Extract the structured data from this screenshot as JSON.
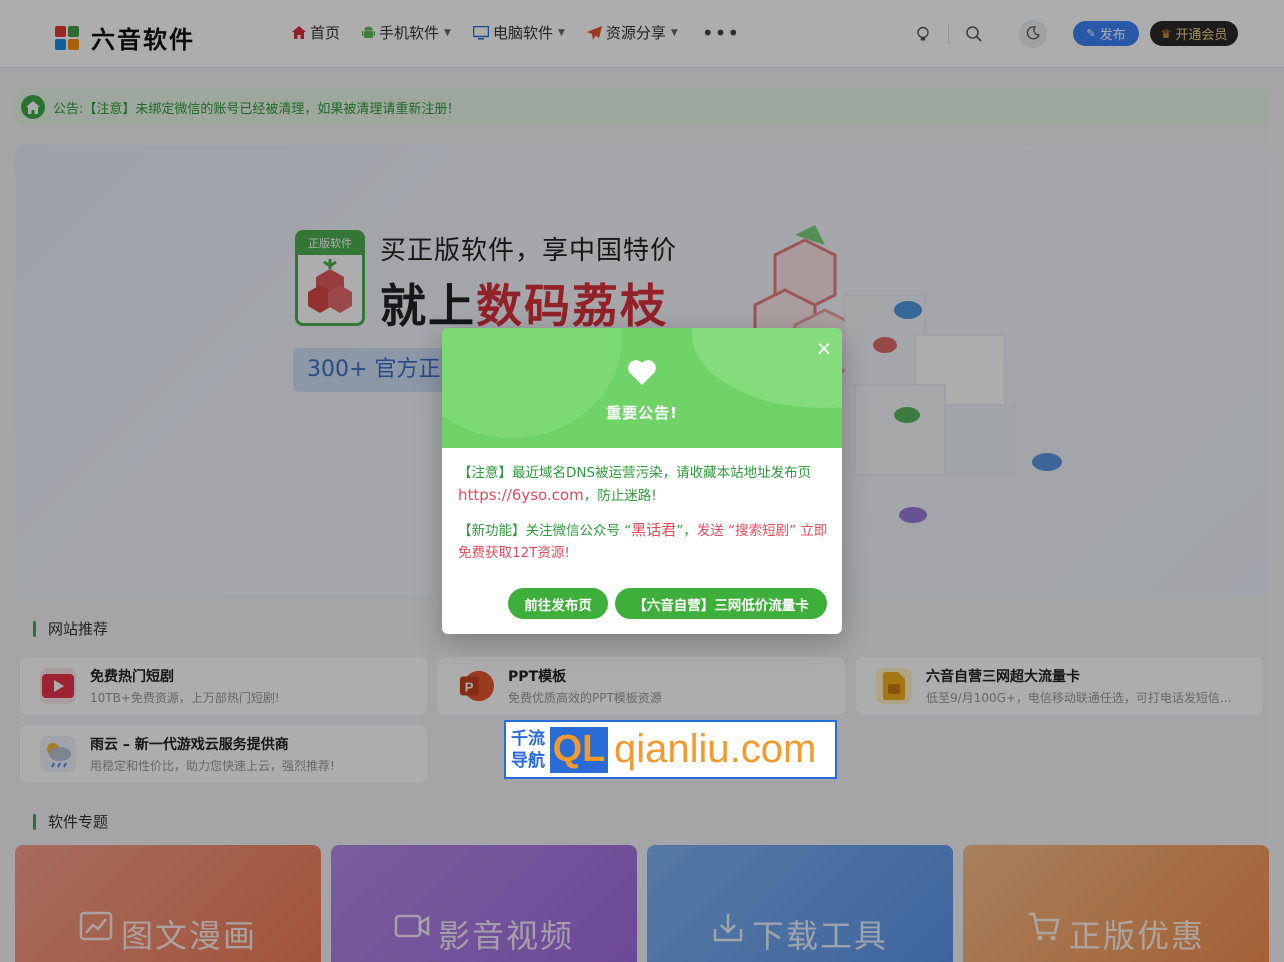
{
  "header": {
    "site_name": "六音软件",
    "nav": [
      {
        "label": "首页",
        "icon": "home-icon"
      },
      {
        "label": "手机软件",
        "icon": "android-icon"
      },
      {
        "label": "电脑软件",
        "icon": "monitor-icon"
      },
      {
        "label": "资源分享",
        "icon": "paper-plane-icon"
      }
    ],
    "more": "•••",
    "publish_label": "发布",
    "vip_label": "开通会员"
  },
  "notice": {
    "text": "公告:【注意】未绑定微信的账号已经被清理，如果被清理请重新注册!"
  },
  "banner": {
    "badge": "正版软件",
    "line1": "买正版软件，享中国特价",
    "line2_dark": "就上",
    "line2_red": "数码荔枝",
    "pill": "300+ 官方正品"
  },
  "sections": {
    "sites_title": "网站推荐",
    "topics_title": "软件专题"
  },
  "sites": [
    {
      "name": "免费热门短剧",
      "desc": "10TB+免费资源，上万部热门短剧!"
    },
    {
      "name": "PPT模板",
      "desc": "免费优质高效的PPT模板资源"
    },
    {
      "name": "六音自营三网超大流量卡",
      "desc": "低至9/月100G+，电信移动联通任选，可打电话发短信..."
    },
    {
      "name": "雨云 – 新一代游戏云服务提供商",
      "desc": "用稳定和性价比，助力您快速上云，强烈推荐!"
    }
  ],
  "watermark": {
    "cn_line1": "千流",
    "cn_line2": "导航",
    "badge": "QL",
    "url": "qianliu.com"
  },
  "topics": [
    {
      "label": "图文漫画"
    },
    {
      "label": "影音视频"
    },
    {
      "label": "下载工具"
    },
    {
      "label": "正版优惠"
    }
  ],
  "modal": {
    "title": "重要公告!",
    "p1_text": "【注意】最近域名DNS被运营污染，请收藏本站地址发布页",
    "p1_url": "https://6yso.com",
    "p1_tail": "，防止迷路!",
    "p2_a": "【新功能】关注微信公众号 “",
    "p2_name": "黑话君",
    "p2_b": "”，",
    "p2_c": "发送 “搜索短剧” 立即免费获取12T资源!",
    "btn_primary": "前往发布页",
    "btn_secondary": "【六音自营】三网低价流量卡"
  }
}
